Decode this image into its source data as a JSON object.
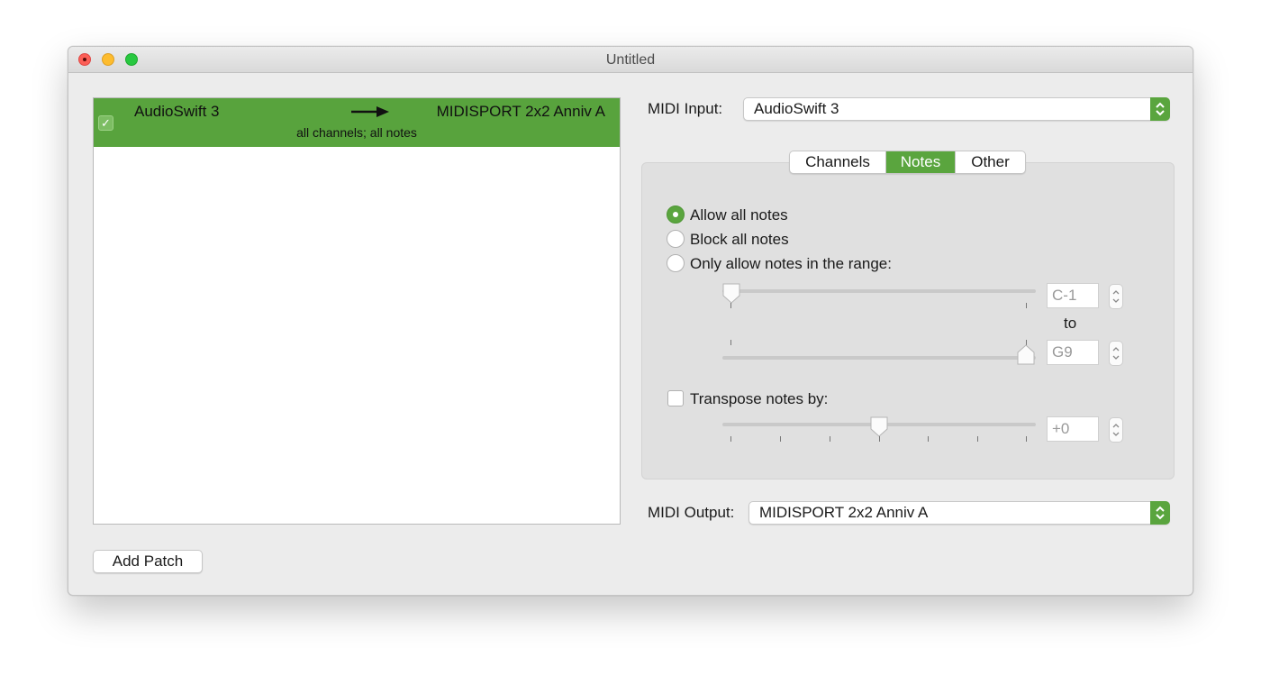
{
  "window": {
    "title": "Untitled"
  },
  "patches": [
    {
      "enabled": true,
      "source": "AudioSwift 3",
      "destination": "MIDISPORT 2x2 Anniv A",
      "summary": "all channels; all notes"
    }
  ],
  "add_patch_label": "Add Patch",
  "midi_input": {
    "label": "MIDI Input:",
    "value": "AudioSwift 3"
  },
  "midi_output": {
    "label": "MIDI Output:",
    "value": "MIDISPORT 2x2 Anniv A"
  },
  "tabs": [
    {
      "label": "Channels",
      "active": false
    },
    {
      "label": "Notes",
      "active": true
    },
    {
      "label": "Other",
      "active": false
    }
  ],
  "notes": {
    "options": [
      {
        "label": "Allow all notes",
        "selected": true
      },
      {
        "label": "Block all notes",
        "selected": false
      },
      {
        "label": "Only allow notes in the range:",
        "selected": false
      }
    ],
    "range_low": "C-1",
    "range_separator": "to",
    "range_high": "G9",
    "transpose_label": "Transpose notes by:",
    "transpose_enabled": false,
    "transpose_value": "+0"
  },
  "colors": {
    "accent": "#5aa53e",
    "selected_row": "#58a33d"
  }
}
